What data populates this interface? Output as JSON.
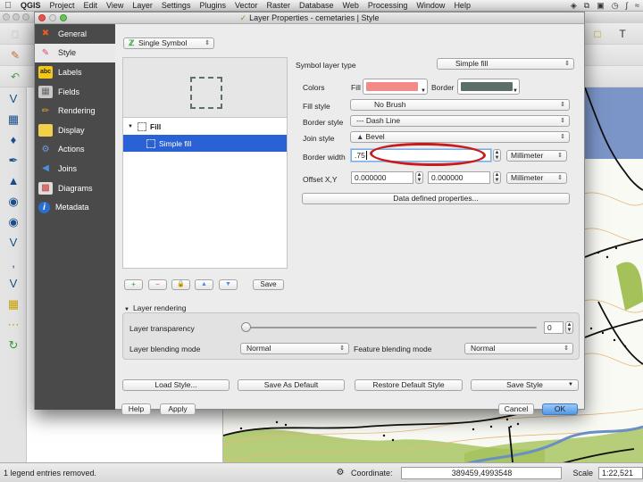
{
  "menubar": {
    "app": "QGIS",
    "items": [
      "Project",
      "Edit",
      "View",
      "Layer",
      "Settings",
      "Plugins",
      "Vector",
      "Raster",
      "Database",
      "Web",
      "Processing",
      "Window",
      "Help"
    ]
  },
  "dialog": {
    "title": "Layer Properties - cemetaries | Style",
    "sidebar": [
      {
        "label": "General",
        "icon": "tools-icon"
      },
      {
        "label": "Style",
        "icon": "paintbrush-icon",
        "active": true
      },
      {
        "label": "Labels",
        "icon": "abc-label-icon"
      },
      {
        "label": "Fields",
        "icon": "table-icon"
      },
      {
        "label": "Rendering",
        "icon": "broom-icon"
      },
      {
        "label": "Display",
        "icon": "speech-bubble-icon"
      },
      {
        "label": "Actions",
        "icon": "gear-icon"
      },
      {
        "label": "Joins",
        "icon": "join-icon"
      },
      {
        "label": "Diagrams",
        "icon": "chart-icon"
      },
      {
        "label": "Metadata",
        "icon": "info-icon"
      }
    ],
    "renderer_select": "Single Symbol",
    "tree": {
      "root": "Fill",
      "child": "Simple fill"
    },
    "tree_buttons": {
      "add": "+",
      "remove": "−",
      "lock": "🔒",
      "up": "▲",
      "down": "▼",
      "save": "Save"
    },
    "symbol_layer_type_label": "Symbol layer type",
    "symbol_layer_type": "Simple fill",
    "colors_label": "Colors",
    "fill_label": "Fill",
    "fill_color": "#f28a8a",
    "border_label": "Border",
    "border_color": "#5b6e6a",
    "fill_style_label": "Fill style",
    "fill_style": "No Brush",
    "border_style_label": "Border style",
    "border_style": "--- Dash Line",
    "join_style_label": "Join style",
    "join_style": "Bevel",
    "border_width_label": "Border width",
    "border_width": ".75",
    "border_width_unit": "Millimeter",
    "offset_label": "Offset X,Y",
    "offset_x": "0.000000",
    "offset_y": "0.000000",
    "offset_unit": "Millimeter",
    "data_defined_button": "Data defined properties...",
    "layer_rendering": {
      "header": "Layer rendering",
      "transparency_label": "Layer transparency",
      "transparency_value": "0",
      "transparency_percent": 0,
      "layer_blending_label": "Layer blending mode",
      "layer_blending": "Normal",
      "feature_blending_label": "Feature blending mode",
      "feature_blending": "Normal"
    },
    "buttons": {
      "load_style": "Load Style...",
      "save_default": "Save As Default",
      "restore_default": "Restore Default Style",
      "save_style": "Save Style",
      "help": "Help",
      "apply": "Apply",
      "cancel": "Cancel",
      "ok": "OK"
    }
  },
  "statusbar": {
    "message": "1 legend entries removed.",
    "coordinate_label": "Coordinate:",
    "coordinate": "389459,4993548",
    "scale_label": "Scale",
    "scale": "1:22,521"
  }
}
